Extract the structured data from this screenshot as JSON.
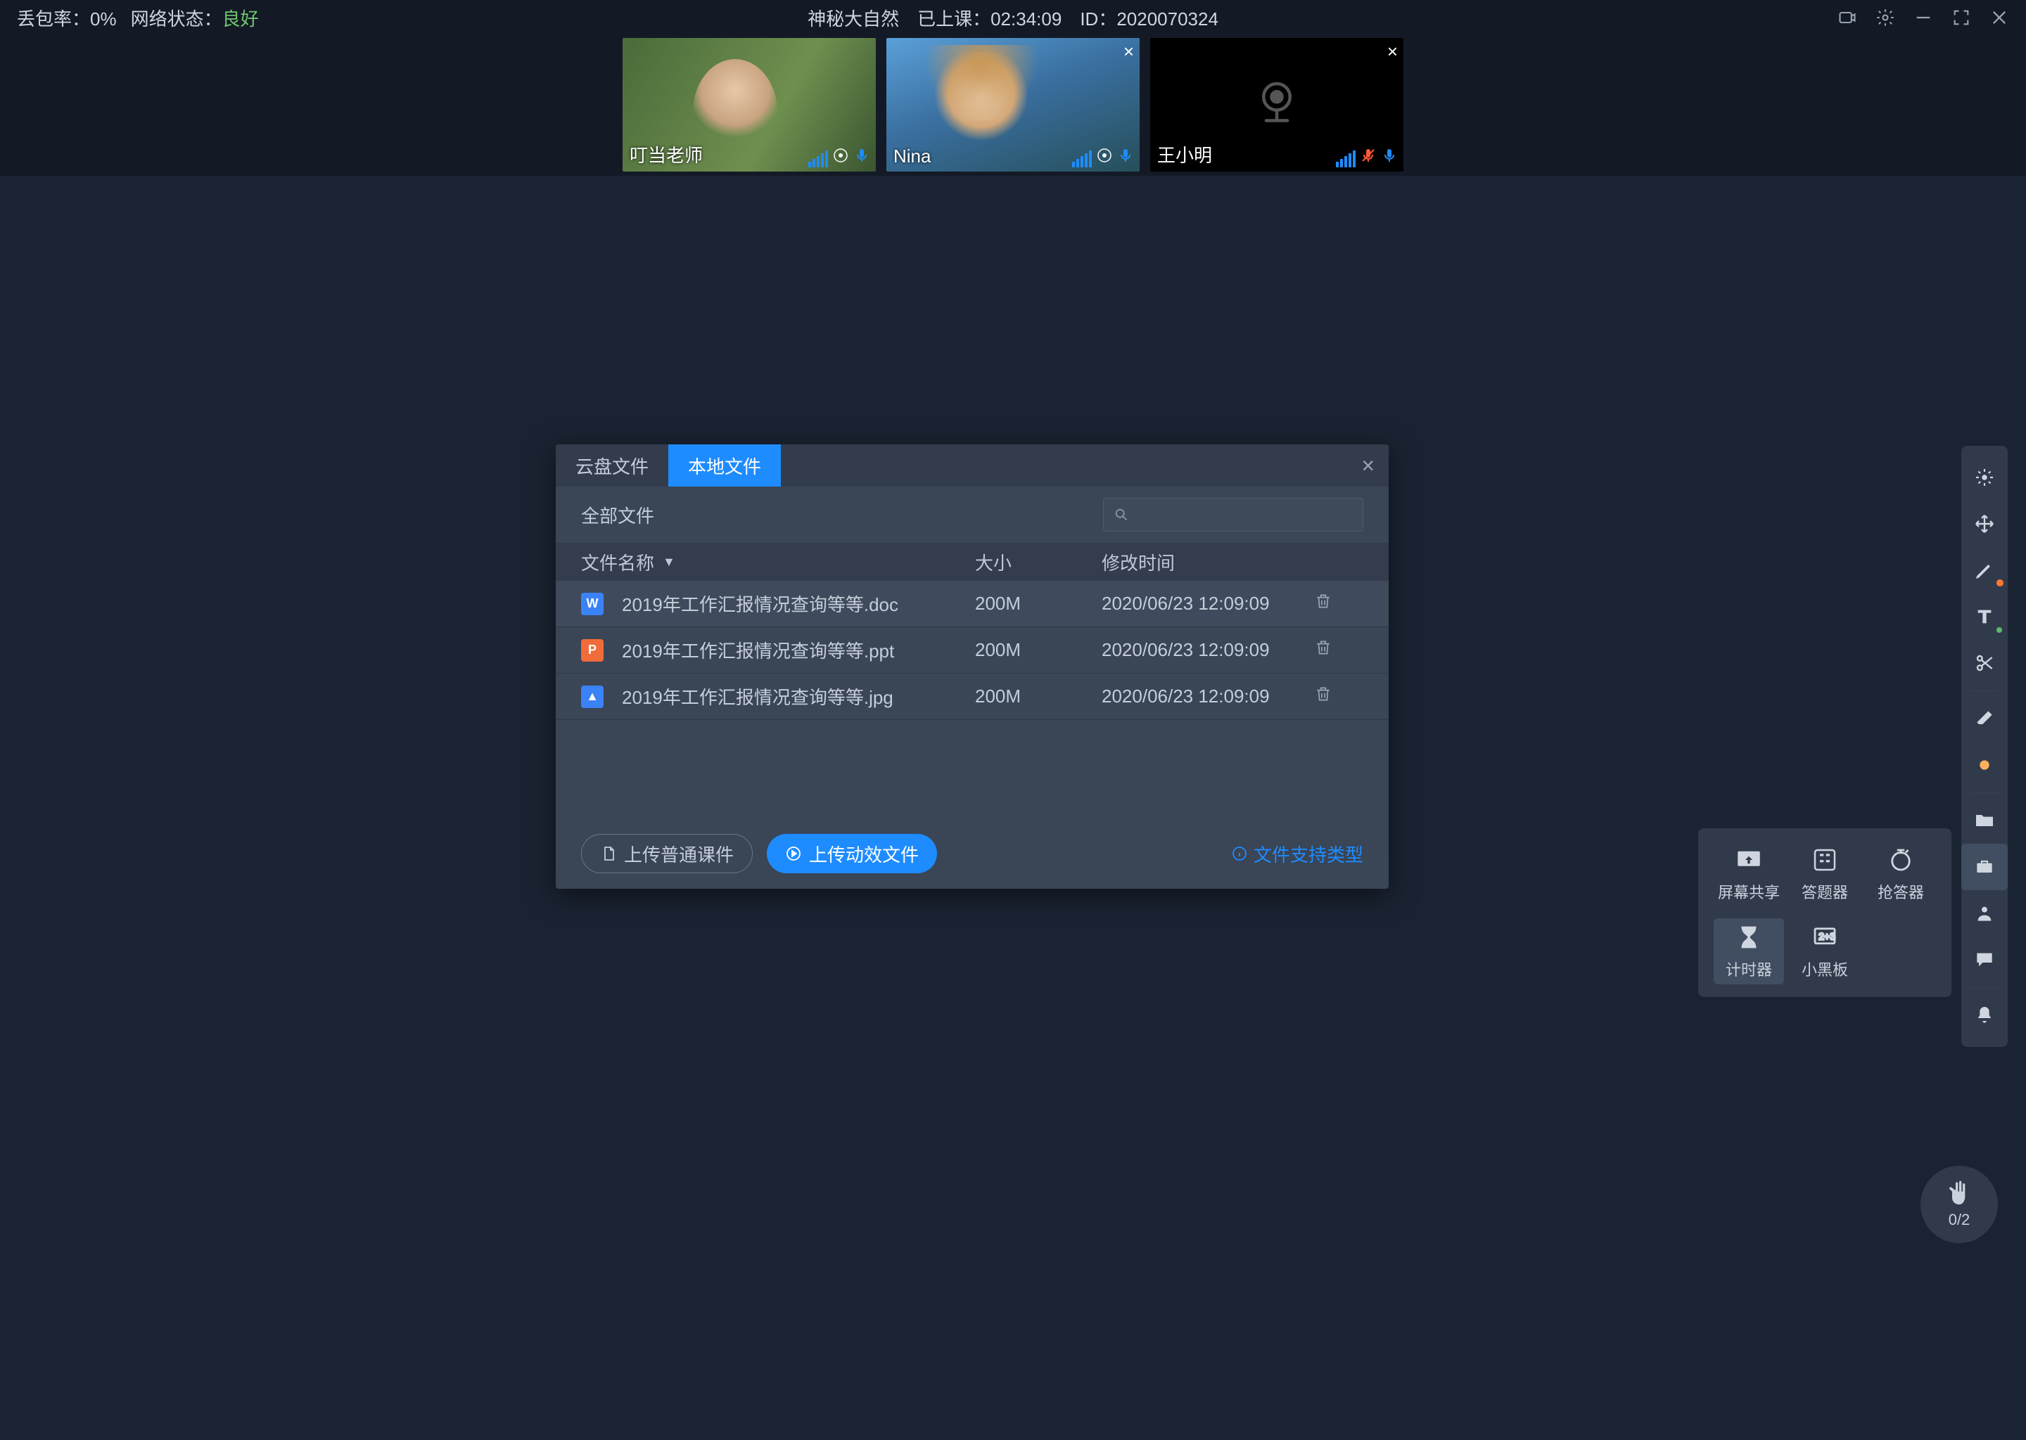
{
  "topbar": {
    "packet_loss_label": "丢包率：",
    "packet_loss_value": "0%",
    "network_label": "网络状态：",
    "network_value": "良好",
    "title": "神秘大自然",
    "duration_label": "已上课：",
    "duration_value": "02:34:09",
    "id_label": "ID：",
    "id_value": "2020070324"
  },
  "participants": [
    {
      "name": "叮当老师",
      "mic_muted": false,
      "cam_off": false,
      "closable": false
    },
    {
      "name": "Nina",
      "mic_muted": false,
      "cam_off": false,
      "closable": true
    },
    {
      "name": "王小明",
      "mic_muted": true,
      "cam_off": true,
      "closable": true
    }
  ],
  "modal": {
    "tabs": {
      "cloud": "云盘文件",
      "local": "本地文件"
    },
    "all_files": "全部文件",
    "columns": {
      "name": "文件名称",
      "size": "大小",
      "time": "修改时间"
    },
    "rows": [
      {
        "icon": "W",
        "icon_color": "#3b82f6",
        "name": "2019年工作汇报情况查询等等.doc",
        "size": "200M",
        "time": "2020/06/23 12:09:09"
      },
      {
        "icon": "P",
        "icon_color": "#f26b3a",
        "name": "2019年工作汇报情况查询等等.ppt",
        "size": "200M",
        "time": "2020/06/23 12:09:09"
      },
      {
        "icon": "▲",
        "icon_color": "#3b82f6",
        "name": "2019年工作汇报情况查询等等.jpg",
        "size": "200M",
        "time": "2020/06/23 12:09:09"
      }
    ],
    "upload_normal": "上传普通课件",
    "upload_animated": "上传动效文件",
    "hint": "文件支持类型"
  },
  "tools": {
    "screen_share": "屏幕共享",
    "answer_device": "答题器",
    "responder": "抢答器",
    "timer": "计时器",
    "blackboard": "小黑板"
  },
  "hand": {
    "count": "0/2"
  }
}
